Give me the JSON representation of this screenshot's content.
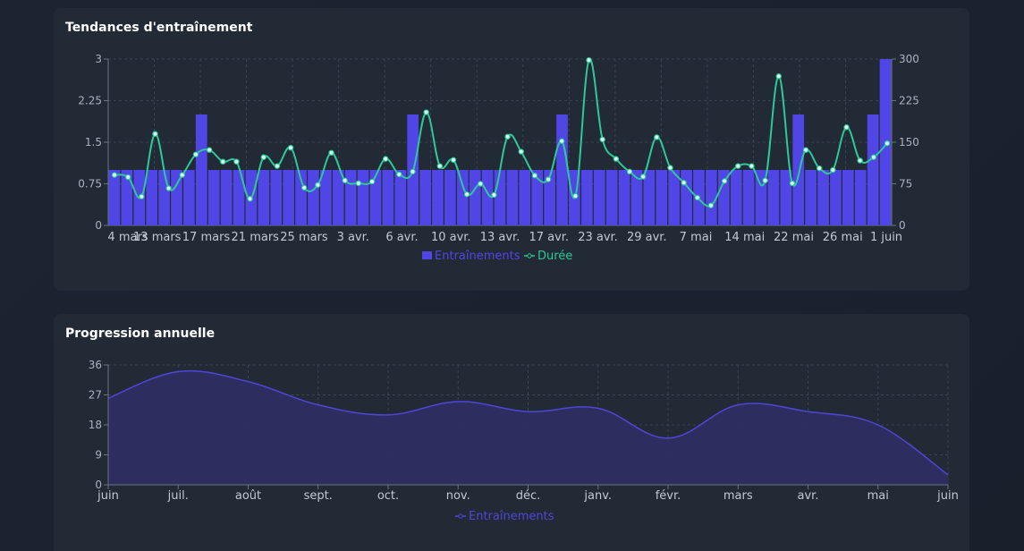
{
  "colors": {
    "bar": "#5046e5",
    "line": "#2ec89a",
    "area_line": "#4f46d8",
    "area_fill": "#2f2d62",
    "grid": "#3a4352",
    "tick": "#aab2bf"
  },
  "cards": {
    "trends_title": "Tendances d'entraînement",
    "annual_title": "Progression annuelle"
  },
  "chart_data": [
    {
      "type": "bar",
      "title": "Tendances d'entraînement",
      "x_tick_labels": [
        "4 mars",
        "13 mars",
        "17 mars",
        "21 mars",
        "25 mars",
        "3 avr.",
        "6 avr.",
        "10 avr.",
        "13 avr.",
        "17 avr.",
        "23 avr.",
        "29 avr.",
        "7 mai",
        "14 mai",
        "22 mai",
        "26 mai",
        "1 juin"
      ],
      "ylim_left": [
        0,
        3
      ],
      "yticks_left": [
        "0",
        "0.75",
        "1.5",
        "2.25",
        "3"
      ],
      "ylim_right": [
        0,
        300
      ],
      "yticks_right": [
        "0",
        "75",
        "150",
        "225",
        "300"
      ],
      "legend_position": "bottom",
      "grid": true,
      "series": [
        {
          "name": "Entraînements",
          "type": "bar",
          "axis": "left",
          "values": [
            1,
            1,
            1,
            1,
            1,
            1,
            1,
            2,
            1,
            1,
            1,
            1,
            1,
            1,
            1,
            1,
            1,
            1,
            1,
            1,
            1,
            1,
            1,
            1,
            2,
            1,
            1,
            1,
            1,
            1,
            1,
            1,
            1,
            1,
            1,
            1,
            2,
            1,
            1,
            1,
            1,
            1,
            1,
            1,
            1,
            1,
            1,
            1,
            1,
            1,
            1,
            1,
            1,
            1,
            1,
            2,
            1,
            1,
            1,
            1,
            1,
            2,
            3
          ]
        },
        {
          "name": "Durée",
          "type": "line",
          "axis": "right",
          "values": [
            91,
            87,
            52,
            165,
            67,
            91,
            128,
            136,
            115,
            115,
            48,
            123,
            107,
            140,
            68,
            73,
            131,
            81,
            76,
            79,
            120,
            92,
            97,
            204,
            107,
            118,
            56,
            75,
            55,
            160,
            133,
            90,
            83,
            152,
            53,
            298,
            155,
            120,
            97,
            88,
            159,
            104,
            77,
            50,
            36,
            80,
            107,
            107,
            81,
            269,
            76,
            136,
            103,
            100,
            177,
            117,
            123,
            148
          ]
        }
      ]
    },
    {
      "type": "area",
      "title": "Progression annuelle",
      "categories": [
        "juin",
        "juil.",
        "août",
        "sept.",
        "oct.",
        "nov.",
        "déc.",
        "janv.",
        "févr.",
        "mars",
        "avr.",
        "mai",
        "juin"
      ],
      "ylim": [
        0,
        36
      ],
      "yticks": [
        "0",
        "9",
        "18",
        "27",
        "36"
      ],
      "legend_position": "bottom",
      "grid": true,
      "series": [
        {
          "name": "Entraînements",
          "values": [
            26,
            34,
            31,
            24,
            21,
            25,
            22,
            23,
            14,
            24,
            22,
            18,
            3
          ]
        }
      ]
    }
  ]
}
